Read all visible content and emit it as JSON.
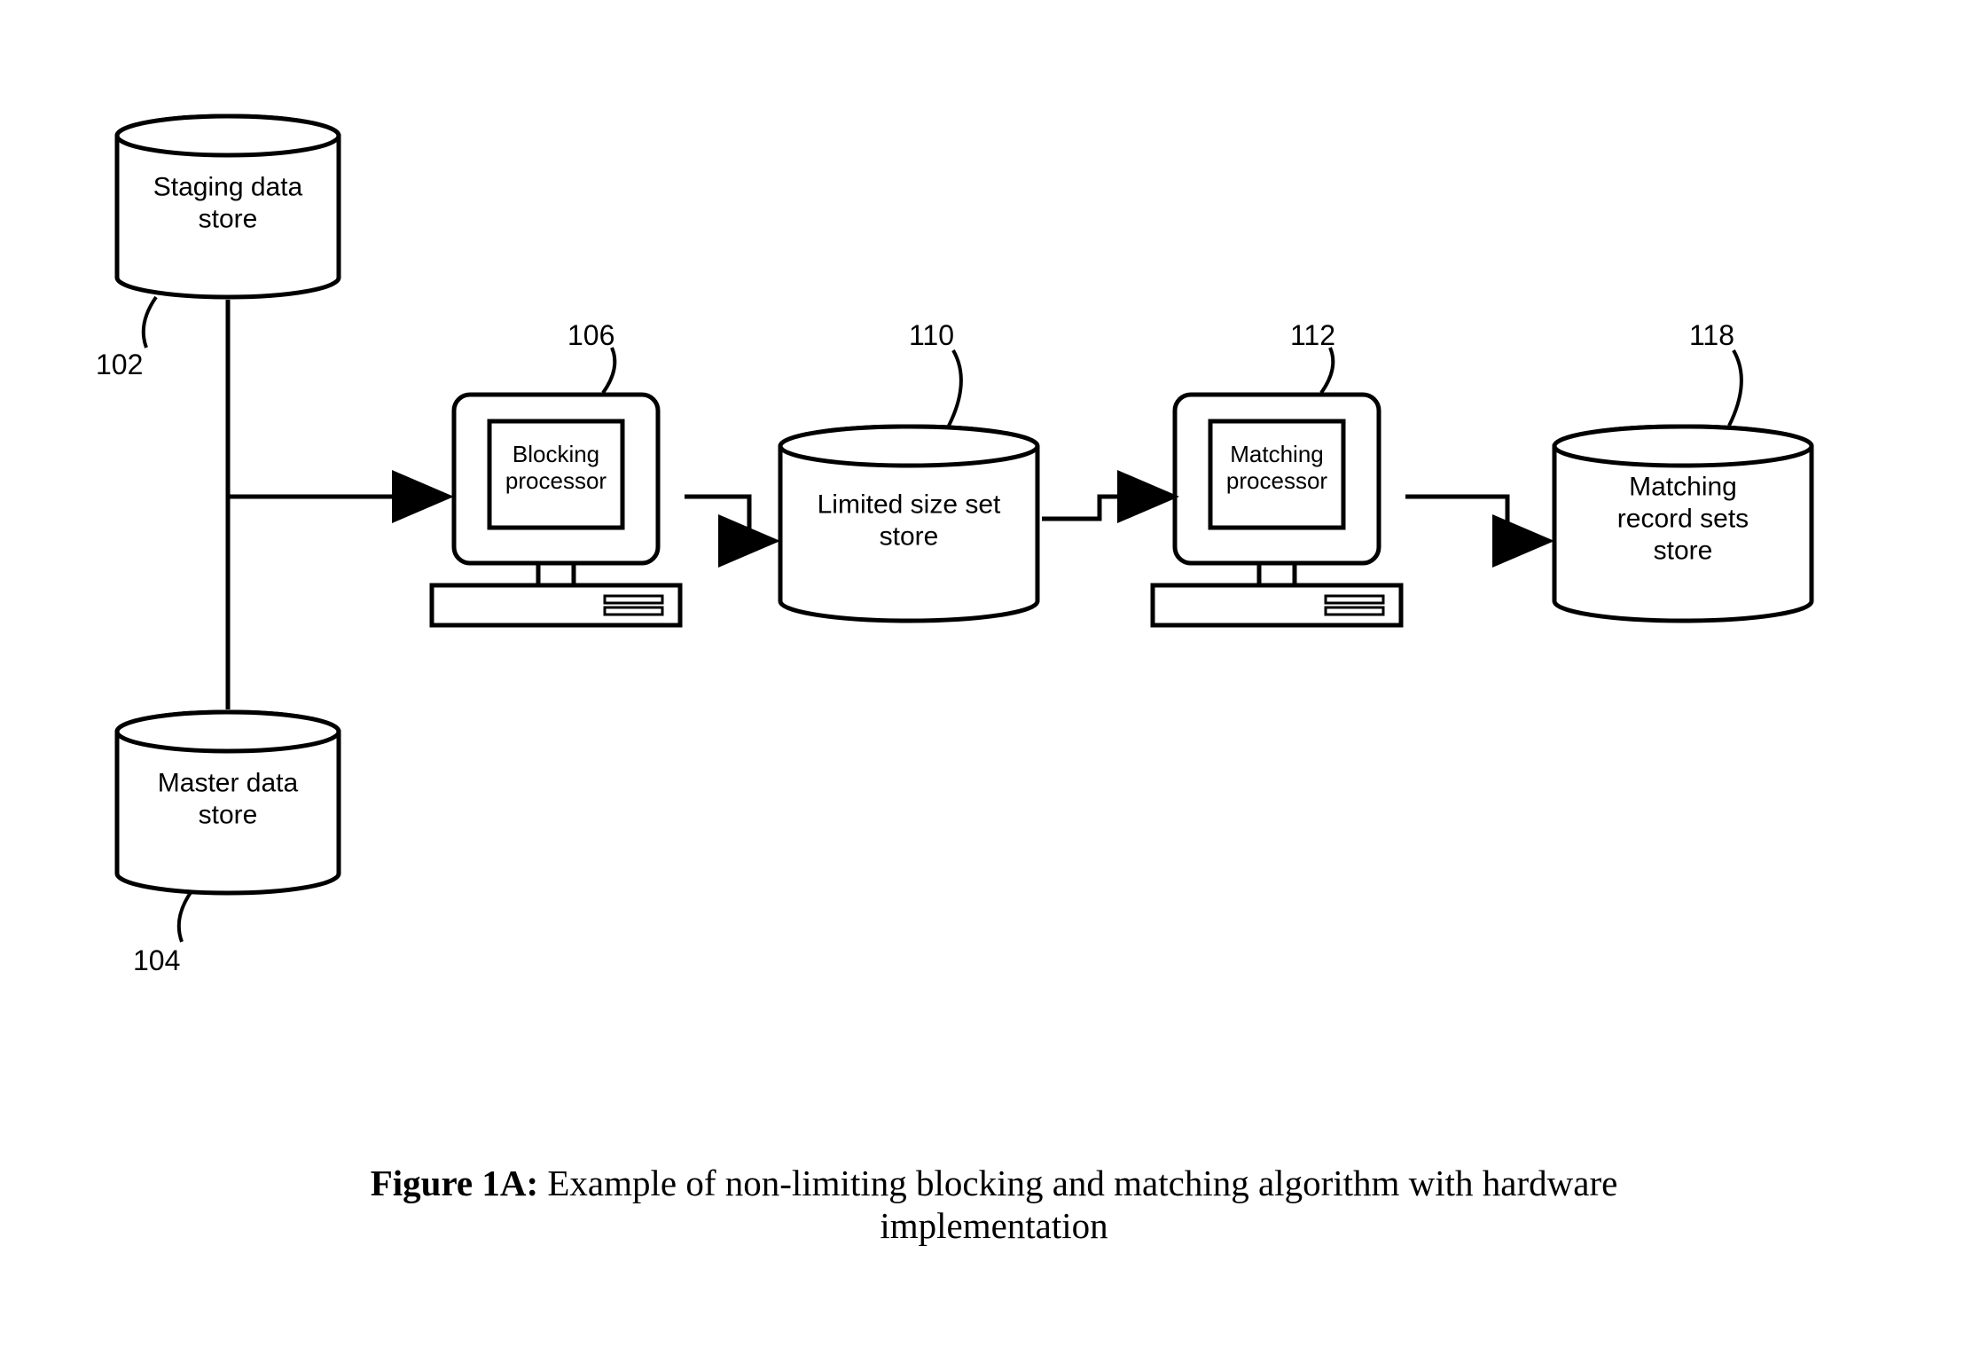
{
  "nodes": {
    "staging": {
      "label_l1": "Staging data",
      "label_l2": "store",
      "ref": "102"
    },
    "master": {
      "label_l1": "Master data",
      "label_l2": "store",
      "ref": "104"
    },
    "blocking": {
      "label_l1": "Blocking",
      "label_l2": "processor",
      "ref": "106"
    },
    "limited": {
      "label_l1": "Limited size set",
      "label_l2": "store",
      "ref": "110"
    },
    "matching": {
      "label_l1": "Matching",
      "label_l2": "processor",
      "ref": "112"
    },
    "records": {
      "label_l1": "Matching",
      "label_l2": "record sets",
      "label_l3": "store",
      "ref": "118"
    }
  },
  "caption": {
    "bold": "Figure 1A:",
    "line1_rest": "  Example of non-limiting blocking and matching algorithm with hardware",
    "line2": "implementation"
  }
}
